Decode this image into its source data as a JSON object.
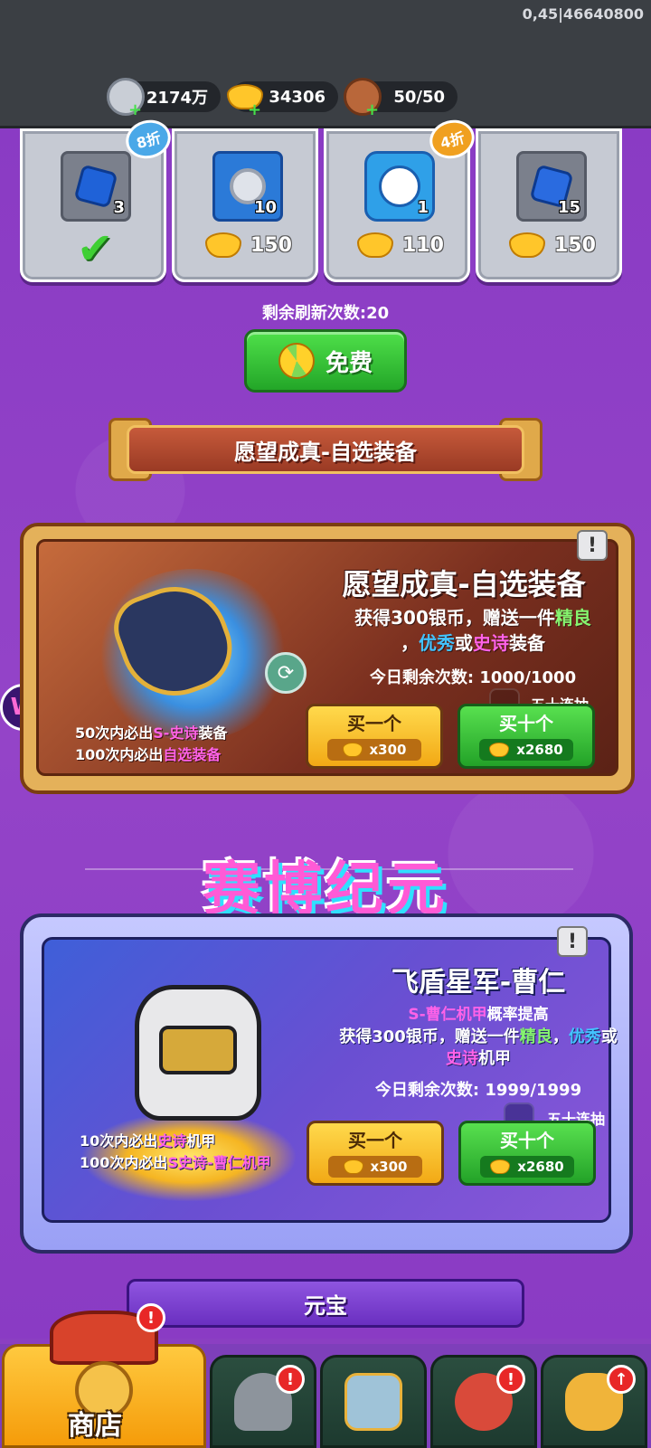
{
  "header": {
    "build_id": "0,45|46640800",
    "resources": [
      {
        "name": "silver",
        "value": "2174万",
        "icon": "silver-coin-icon"
      },
      {
        "name": "gold",
        "value": "34306",
        "icon": "gold-ingot-icon"
      },
      {
        "name": "stamina",
        "value": "50/50",
        "icon": "meat-icon"
      }
    ]
  },
  "shop_items": [
    {
      "icon": "blue-gem-icon",
      "count": "3",
      "purchased": true,
      "discount": "8折"
    },
    {
      "icon": "silver-coin-fast-icon",
      "count": "10",
      "price": "150"
    },
    {
      "icon": "fox-emblem-icon",
      "count": "1",
      "price": "110",
      "discount": "4折"
    },
    {
      "icon": "blue-crystal-icon",
      "count": "15",
      "price": "150"
    }
  ],
  "refresh": {
    "remaining_label": "剩余刷新次数:20",
    "free_button": "免费"
  },
  "section1": {
    "banner": "愿望成真-自选装备",
    "title": "愿望成真-自选装备",
    "desc_line1_a": "获得300银币，赠送一件",
    "desc_line1_b": "精良",
    "desc_line2_a": "，",
    "desc_line2_b": "优秀",
    "desc_line2_c": "或",
    "desc_line2_d": "史诗",
    "desc_line2_e": "装备",
    "remaining": "今日剩余次数: 1000/1000",
    "fifty_label": "五十连抽",
    "guarantee1_a": "50次内必出",
    "guarantee1_b": "S-史诗",
    "guarantee1_c": "装备",
    "guarantee2_a": "100次内必出",
    "guarantee2_b": "自选装备",
    "buy_one": "买一个",
    "buy_one_cost": "x300",
    "buy_ten": "买十个",
    "buy_ten_cost": "x2680"
  },
  "section2": {
    "event_title": "赛博纪元",
    "title": "飞盾星军-曹仁",
    "sub_a": "S-曹仁机甲",
    "sub_b": "概率提高",
    "desc_line1_a": "获得300银币，赠送一件",
    "desc_line1_b": "精良",
    "desc_line1_c": "，",
    "desc_line1_d": "优秀",
    "desc_line1_e": "或",
    "desc_line2_a": "史诗",
    "desc_line2_b": "机甲",
    "remaining": "今日剩余次数: 1999/1999",
    "fifty_label": "五十连抽",
    "guarantee1_a": "10次内必出",
    "guarantee1_b": "史诗",
    "guarantee1_c": "机甲",
    "guarantee2_a": "100次内必出",
    "guarantee2_b": "S史诗-曹仁机甲",
    "buy_one": "买一个",
    "buy_one_cost": "x300",
    "buy_ten": "买十个",
    "buy_ten_cost": "x2680"
  },
  "section3": {
    "banner": "元宝"
  },
  "nav": {
    "shop_label": "商店",
    "tabs": [
      {
        "icon": "shop-icon",
        "badge": "!"
      },
      {
        "icon": "helmet-icon",
        "badge": "!"
      },
      {
        "icon": "sword-shield-icon",
        "badge": ""
      },
      {
        "icon": "rooster-icon",
        "badge": "!"
      },
      {
        "icon": "fist-upgrade-icon",
        "badge": "↑"
      }
    ]
  },
  "side_button": "W",
  "info_icon": "!",
  "check_mark": "✔",
  "colors": {
    "background": "#8b3fc2",
    "good": "#86f56f",
    "excellent": "#43c3ff",
    "epic": "#ff62e8"
  }
}
